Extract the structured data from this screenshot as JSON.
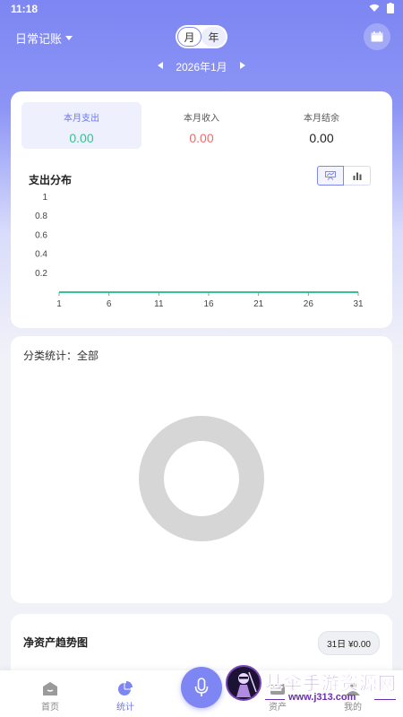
{
  "status_bar": {
    "time": "11:18"
  },
  "header": {
    "book_name": "日常记账",
    "period_month": "月",
    "period_year": "年",
    "calendar_icon": "calendar-icon"
  },
  "date_nav": {
    "label": "2026年1月"
  },
  "summary": [
    {
      "label": "本月支出",
      "value": "0.00",
      "color": "#34c38f"
    },
    {
      "label": "本月收入",
      "value": "0.00",
      "color": "#ef6b6b"
    },
    {
      "label": "本月结余",
      "value": "0.00",
      "color": "#222222"
    }
  ],
  "expense_chart": {
    "title": "支出分布"
  },
  "chart_data": {
    "type": "line",
    "x": [
      1,
      2,
      3,
      4,
      5,
      6,
      7,
      8,
      9,
      10,
      11,
      12,
      13,
      14,
      15,
      16,
      17,
      18,
      19,
      20,
      21,
      22,
      23,
      24,
      25,
      26,
      27,
      28,
      29,
      30,
      31
    ],
    "series": [
      {
        "values": [
          0,
          0,
          0,
          0,
          0,
          0,
          0,
          0,
          0,
          0,
          0,
          0,
          0,
          0,
          0,
          0,
          0,
          0,
          0,
          0,
          0,
          0,
          0,
          0,
          0,
          0,
          0,
          0,
          0,
          0,
          0
        ]
      }
    ],
    "x_ticks": [
      "1",
      "6",
      "11",
      "16",
      "21",
      "26",
      "31"
    ],
    "y_ticks": [
      "0.2",
      "0.4",
      "0.6",
      "0.8",
      "1"
    ],
    "ylim": [
      0,
      1
    ],
    "line_color": "#34c38f"
  },
  "category": {
    "title": "分类统计：全部"
  },
  "trend": {
    "title": "净资产趋势图",
    "badge": "31日 ¥0.00"
  },
  "nav": {
    "home": "首页",
    "stats": "统计",
    "assets": "资产",
    "mine": "我的"
  },
  "watermark": {
    "title": "基伞手游资源网",
    "url": "www.j313.com"
  },
  "colors": {
    "accent": "#7d86f2",
    "expense": "#34c38f",
    "income": "#ef6b6b"
  }
}
